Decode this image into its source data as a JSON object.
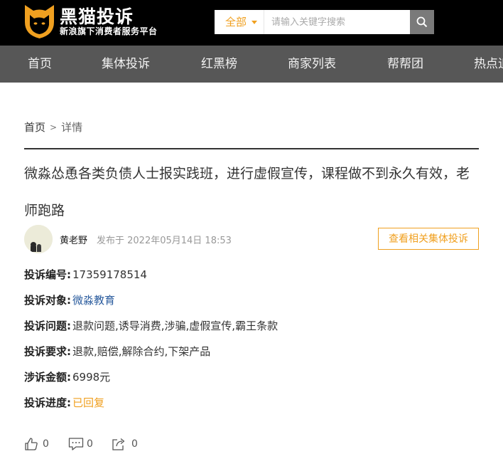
{
  "header": {
    "logo_title": "黑猫投诉",
    "logo_subtitle": "新浪旗下消费者服务平台",
    "search_category": "全部",
    "search_placeholder": "请输入关键字搜索"
  },
  "nav": {
    "items": [
      "首页",
      "集体投诉",
      "红黑榜",
      "商家列表",
      "帮帮团",
      "热点追踪"
    ]
  },
  "breadcrumb": {
    "home": "首页",
    "separator": ">",
    "current": "详情"
  },
  "complaint": {
    "title": "微淼怂恿各类负债人士报实践班，进行虚假宣传，课程做不到永久有效，老师跑路",
    "author": "黄老野",
    "posted": "发布于 2022年05月14日 18:53",
    "related_button": "查看相关集体投诉",
    "fields": [
      {
        "label": "投诉编号:",
        "value": "17359178514"
      },
      {
        "label": "投诉对象:",
        "value": "微淼教育"
      },
      {
        "label": "投诉问题:",
        "value": "退款问题,诱导消费,涉骗,虚假宣传,霸王条款"
      },
      {
        "label": "投诉要求:",
        "value": "退款,赔偿,解除合约,下架产品"
      },
      {
        "label": "涉诉金额:",
        "value": "6998元"
      },
      {
        "label": "投诉进度:",
        "value": "已回复"
      }
    ]
  },
  "actions": {
    "like_count": "0",
    "comment_count": "0",
    "share_count": "0"
  },
  "colors": {
    "accent": "#f0a020",
    "nav_bg": "#575757",
    "header_bg": "#000000",
    "link": "#2b5c9e"
  }
}
